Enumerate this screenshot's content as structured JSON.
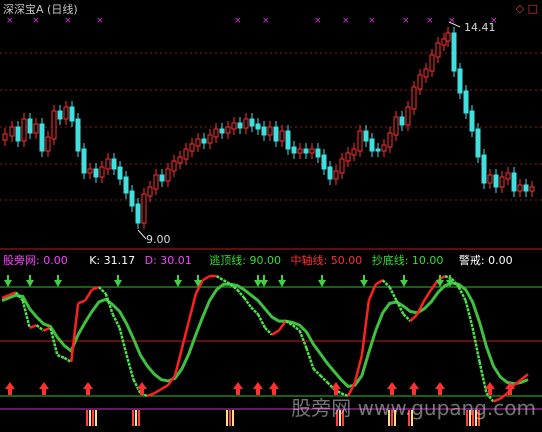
{
  "header": {
    "title": "深深宝A (日线)",
    "window_icons": "◇ □",
    "high_label": "14.41",
    "low_label": "9.00"
  },
  "indicator": {
    "name": "股旁网",
    "name_value": ": 0.00",
    "k_label": "K: 31.17",
    "d_label": "D: 30.01",
    "top_line": "逃顶线: 90.00",
    "mid_line": "中轴线: 50.00",
    "bottom_line": "抄底线: 10.00",
    "warn": "警戒: 0.00",
    "colors": {
      "name": "#ff40ff",
      "k": "#ffffff",
      "d": "#ff40ff",
      "top": "#30e030",
      "mid": "#ff3030",
      "bottom": "#30e030",
      "warn": "#ffffff"
    }
  },
  "watermark": "股旁网 www.gupang.com",
  "chart_data": {
    "type": "candlestick",
    "series": [
      {
        "name": "K",
        "values": [
          82,
          84,
          86,
          80,
          60,
          62,
          58,
          60,
          40,
          38,
          35,
          78,
          80,
          88,
          90,
          85,
          70,
          60,
          40,
          22,
          12,
          10,
          12,
          15,
          18,
          25,
          45,
          65,
          85,
          95,
          98,
          98,
          95,
          92,
          88,
          82,
          75,
          70,
          60,
          55,
          58,
          65,
          62,
          58,
          45,
          30,
          25,
          20,
          15,
          12,
          10,
          20,
          40,
          80,
          92,
          95,
          90,
          80,
          70,
          65,
          70,
          80,
          88,
          95,
          98,
          96,
          90,
          80,
          60,
          35,
          12,
          6,
          8,
          12,
          18,
          22,
          26
        ]
      },
      {
        "name": "D",
        "values": [
          80,
          82,
          84,
          83,
          74,
          68,
          63,
          61,
          53,
          47,
          43,
          55,
          64,
          72,
          79,
          81,
          77,
          72,
          63,
          52,
          40,
          32,
          26,
          22,
          21,
          23,
          30,
          41,
          55,
          68,
          80,
          88,
          92,
          92,
          91,
          88,
          84,
          80,
          74,
          68,
          65,
          65,
          64,
          62,
          57,
          48,
          41,
          34,
          28,
          22,
          17,
          18,
          25,
          42,
          58,
          71,
          78,
          79,
          76,
          72,
          71,
          74,
          79,
          86,
          91,
          93,
          92,
          88,
          79,
          64,
          46,
          32,
          24,
          20,
          19,
          20,
          22
        ]
      }
    ],
    "levels": {
      "top": 90,
      "mid": 50,
      "bottom": 10
    },
    "price_high": 14.41,
    "price_low": 9.0
  }
}
